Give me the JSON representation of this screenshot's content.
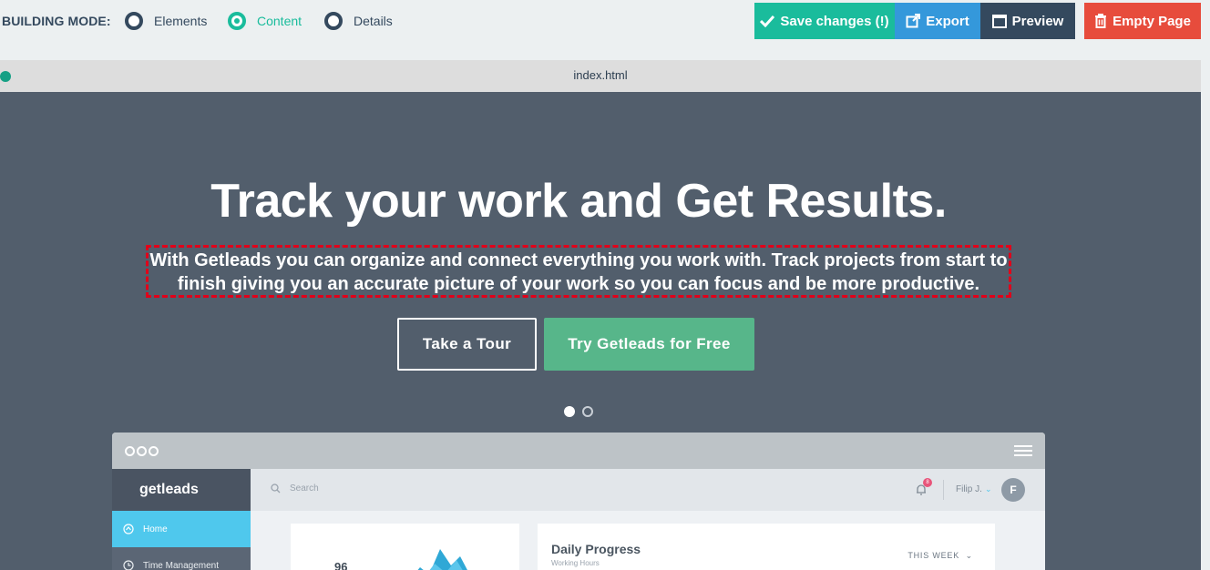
{
  "toolbar": {
    "mode_label": "BUILDING MODE:",
    "modes": [
      {
        "label": "Elements",
        "active": false
      },
      {
        "label": "Content",
        "active": true
      },
      {
        "label": "Details",
        "active": false
      }
    ],
    "buttons": {
      "save": "Save changes (!)",
      "export": "Export",
      "preview": "Preview",
      "empty": "Empty Page"
    },
    "colors": {
      "save": "#1abc9c",
      "export": "#3498db",
      "preview": "#34495e",
      "empty": "#e74c3c"
    }
  },
  "filebar": {
    "filename": "index.html"
  },
  "hero": {
    "title": "Track your work and Get Results.",
    "subtitle": "With Getleads you can organize and connect everything you work with. Track projects from start to finish giving you an accurate picture of your work so you can focus and be more productive.",
    "cta_tour": "Take a Tour",
    "cta_free": "Try Getleads for Free",
    "slides": 2,
    "active_slide": 1,
    "background": "#525e6c"
  },
  "mock_app": {
    "brand": "getleads",
    "nav": [
      {
        "label": "Home",
        "icon": "home-icon",
        "active": true
      },
      {
        "label": "Time Management",
        "icon": "clock-icon",
        "active": false
      }
    ],
    "search_placeholder": "Search",
    "notifications": "8",
    "user": "Filip J.",
    "avatar": "F",
    "card_value": "96",
    "progress_title": "Daily Progress",
    "progress_sub": "Working Hours",
    "period": "THIS WEEK"
  }
}
